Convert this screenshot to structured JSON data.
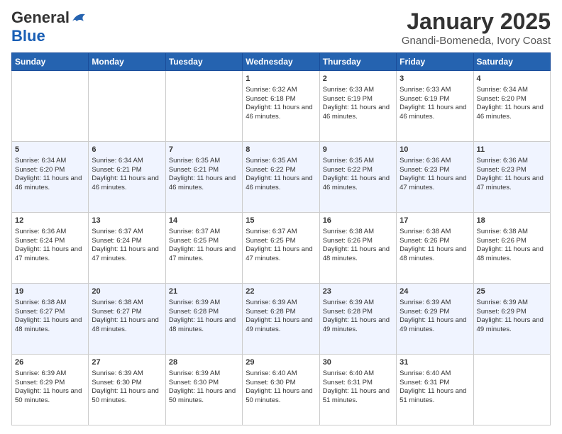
{
  "logo": {
    "general": "General",
    "blue": "Blue"
  },
  "header": {
    "title": "January 2025",
    "location": "Gnandi-Bomeneda, Ivory Coast"
  },
  "days_of_week": [
    "Sunday",
    "Monday",
    "Tuesday",
    "Wednesday",
    "Thursday",
    "Friday",
    "Saturday"
  ],
  "weeks": [
    [
      {
        "day": "",
        "info": ""
      },
      {
        "day": "",
        "info": ""
      },
      {
        "day": "",
        "info": ""
      },
      {
        "day": "1",
        "info": "Sunrise: 6:32 AM\nSunset: 6:18 PM\nDaylight: 11 hours and 46 minutes."
      },
      {
        "day": "2",
        "info": "Sunrise: 6:33 AM\nSunset: 6:19 PM\nDaylight: 11 hours and 46 minutes."
      },
      {
        "day": "3",
        "info": "Sunrise: 6:33 AM\nSunset: 6:19 PM\nDaylight: 11 hours and 46 minutes."
      },
      {
        "day": "4",
        "info": "Sunrise: 6:34 AM\nSunset: 6:20 PM\nDaylight: 11 hours and 46 minutes."
      }
    ],
    [
      {
        "day": "5",
        "info": "Sunrise: 6:34 AM\nSunset: 6:20 PM\nDaylight: 11 hours and 46 minutes."
      },
      {
        "day": "6",
        "info": "Sunrise: 6:34 AM\nSunset: 6:21 PM\nDaylight: 11 hours and 46 minutes."
      },
      {
        "day": "7",
        "info": "Sunrise: 6:35 AM\nSunset: 6:21 PM\nDaylight: 11 hours and 46 minutes."
      },
      {
        "day": "8",
        "info": "Sunrise: 6:35 AM\nSunset: 6:22 PM\nDaylight: 11 hours and 46 minutes."
      },
      {
        "day": "9",
        "info": "Sunrise: 6:35 AM\nSunset: 6:22 PM\nDaylight: 11 hours and 46 minutes."
      },
      {
        "day": "10",
        "info": "Sunrise: 6:36 AM\nSunset: 6:23 PM\nDaylight: 11 hours and 47 minutes."
      },
      {
        "day": "11",
        "info": "Sunrise: 6:36 AM\nSunset: 6:23 PM\nDaylight: 11 hours and 47 minutes."
      }
    ],
    [
      {
        "day": "12",
        "info": "Sunrise: 6:36 AM\nSunset: 6:24 PM\nDaylight: 11 hours and 47 minutes."
      },
      {
        "day": "13",
        "info": "Sunrise: 6:37 AM\nSunset: 6:24 PM\nDaylight: 11 hours and 47 minutes."
      },
      {
        "day": "14",
        "info": "Sunrise: 6:37 AM\nSunset: 6:25 PM\nDaylight: 11 hours and 47 minutes."
      },
      {
        "day": "15",
        "info": "Sunrise: 6:37 AM\nSunset: 6:25 PM\nDaylight: 11 hours and 47 minutes."
      },
      {
        "day": "16",
        "info": "Sunrise: 6:38 AM\nSunset: 6:26 PM\nDaylight: 11 hours and 48 minutes."
      },
      {
        "day": "17",
        "info": "Sunrise: 6:38 AM\nSunset: 6:26 PM\nDaylight: 11 hours and 48 minutes."
      },
      {
        "day": "18",
        "info": "Sunrise: 6:38 AM\nSunset: 6:26 PM\nDaylight: 11 hours and 48 minutes."
      }
    ],
    [
      {
        "day": "19",
        "info": "Sunrise: 6:38 AM\nSunset: 6:27 PM\nDaylight: 11 hours and 48 minutes."
      },
      {
        "day": "20",
        "info": "Sunrise: 6:38 AM\nSunset: 6:27 PM\nDaylight: 11 hours and 48 minutes."
      },
      {
        "day": "21",
        "info": "Sunrise: 6:39 AM\nSunset: 6:28 PM\nDaylight: 11 hours and 48 minutes."
      },
      {
        "day": "22",
        "info": "Sunrise: 6:39 AM\nSunset: 6:28 PM\nDaylight: 11 hours and 49 minutes."
      },
      {
        "day": "23",
        "info": "Sunrise: 6:39 AM\nSunset: 6:28 PM\nDaylight: 11 hours and 49 minutes."
      },
      {
        "day": "24",
        "info": "Sunrise: 6:39 AM\nSunset: 6:29 PM\nDaylight: 11 hours and 49 minutes."
      },
      {
        "day": "25",
        "info": "Sunrise: 6:39 AM\nSunset: 6:29 PM\nDaylight: 11 hours and 49 minutes."
      }
    ],
    [
      {
        "day": "26",
        "info": "Sunrise: 6:39 AM\nSunset: 6:29 PM\nDaylight: 11 hours and 50 minutes."
      },
      {
        "day": "27",
        "info": "Sunrise: 6:39 AM\nSunset: 6:30 PM\nDaylight: 11 hours and 50 minutes."
      },
      {
        "day": "28",
        "info": "Sunrise: 6:39 AM\nSunset: 6:30 PM\nDaylight: 11 hours and 50 minutes."
      },
      {
        "day": "29",
        "info": "Sunrise: 6:40 AM\nSunset: 6:30 PM\nDaylight: 11 hours and 50 minutes."
      },
      {
        "day": "30",
        "info": "Sunrise: 6:40 AM\nSunset: 6:31 PM\nDaylight: 11 hours and 51 minutes."
      },
      {
        "day": "31",
        "info": "Sunrise: 6:40 AM\nSunset: 6:31 PM\nDaylight: 11 hours and 51 minutes."
      },
      {
        "day": "",
        "info": ""
      }
    ]
  ]
}
